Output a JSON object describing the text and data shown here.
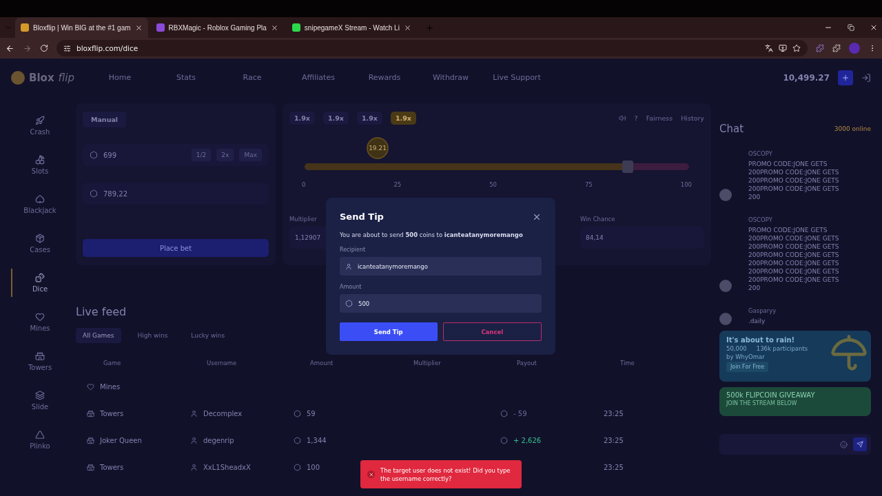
{
  "browser": {
    "tabs": [
      {
        "title": "Bloxflip | Win BIG at the #1 gam",
        "selected": true
      },
      {
        "title": "RBXMagic - Roblox Gaming Pla",
        "selected": false
      },
      {
        "title": "snipegameX Stream - Watch Li",
        "selected": false
      }
    ],
    "url": "bloxflip.com/dice"
  },
  "site": {
    "logo": "Blox",
    "logo_italic": "flip",
    "nav": [
      "Home",
      "Stats",
      "Race",
      "Affiliates",
      "Rewards",
      "Withdraw",
      "Live Support"
    ],
    "balance": "10,499.27"
  },
  "sidebar": [
    {
      "label": "Crash",
      "selected": false
    },
    {
      "label": "Slots",
      "selected": false
    },
    {
      "label": "Blackjack",
      "selected": false
    },
    {
      "label": "Cases",
      "selected": false
    },
    {
      "label": "Dice",
      "selected": true
    },
    {
      "label": "Mines",
      "selected": false
    },
    {
      "label": "Towers",
      "selected": false
    },
    {
      "label": "Slide",
      "selected": false
    },
    {
      "label": "Plinko",
      "selected": false
    }
  ],
  "bet_panel": {
    "mode": "Manual",
    "bet_amount": "699",
    "quick": [
      "1/2",
      "2x",
      "Max"
    ],
    "profit": "789,22",
    "button": "Place bet"
  },
  "dice": {
    "history": [
      {
        "label": "1.9x",
        "selected": false
      },
      {
        "label": "1.9x",
        "selected": false
      },
      {
        "label": "1.9x",
        "selected": false
      },
      {
        "label": "1.9x",
        "selected": true
      }
    ],
    "tools": [
      "?",
      "Fairness",
      "History"
    ],
    "roll": "19.21",
    "level": 0.84,
    "ticks": [
      "0",
      "25",
      "50",
      "75",
      "100"
    ],
    "multiplier_label": "Multiplier",
    "multiplier": "1,12907",
    "win_chance_label": "Win Chance",
    "win_chance": "84,14"
  },
  "live_feed": {
    "title": "Live feed",
    "tabs": [
      {
        "label": "All Games",
        "selected": true
      },
      {
        "label": "High wins",
        "selected": false
      },
      {
        "label": "Lucky wins",
        "selected": false
      }
    ],
    "columns": [
      "Game",
      "Username",
      "Amount",
      "Multiplier",
      "Payout",
      "Time"
    ],
    "filter_row": "Mines",
    "rows": [
      {
        "game": "Towers",
        "user": "Decomplex",
        "amount": "59",
        "payout": "- 59",
        "win": false,
        "time": "23:25"
      },
      {
        "game": "Joker Queen",
        "user": "degenrip",
        "amount": "1,344",
        "payout": "+ 2,626",
        "win": true,
        "time": "23:25"
      },
      {
        "game": "Towers",
        "user": "XxL1SheadxX",
        "amount": "100",
        "time": "23:25"
      }
    ]
  },
  "chat": {
    "title": "Chat",
    "online": "3000 online",
    "messages": [
      {
        "user": "OSCOPY",
        "lines": [
          "PROMO CODE:JONE GETS",
          "200PROMO CODE:JONE GETS",
          "200PROMO CODE:JONE GETS",
          "200PROMO CODE:JONE GETS",
          "200"
        ]
      },
      {
        "user": "OSCOPY",
        "lines": [
          "PROMO CODE:JONE GETS",
          "200PROMO CODE:JONE GETS",
          "200PROMO CODE:JONE GETS",
          "200PROMO CODE:JONE GETS",
          "200PROMO CODE:JONE GETS",
          "200PROMO CODE:JONE GETS",
          "200PROMO CODE:JONE GETS",
          "200"
        ]
      },
      {
        "user": "Gasparyy",
        "lines": [
          ".daily"
        ]
      }
    ],
    "rain": {
      "title": "It's about to rain!",
      "amount": "50,000",
      "participants": "136k participants",
      "host": "by WhyOmar",
      "button": "Join For Free"
    },
    "promo": {
      "title": "500k FLIPCOIN GIVEAWAY",
      "subtitle": "JOIN THE STREAM BELOW"
    }
  },
  "modal": {
    "title": "Send Tip",
    "message": "You are about to send **500** coins to **icanteatanymoremango**",
    "recipient_label": "Recipient",
    "recipient": "icanteatanymoremango",
    "amount_label": "Amount",
    "amount": "500",
    "confirm": "Send Tip",
    "cancel": "Cancel"
  },
  "toast": {
    "message": "The target user does not exist! Did you type the username correctly?"
  }
}
